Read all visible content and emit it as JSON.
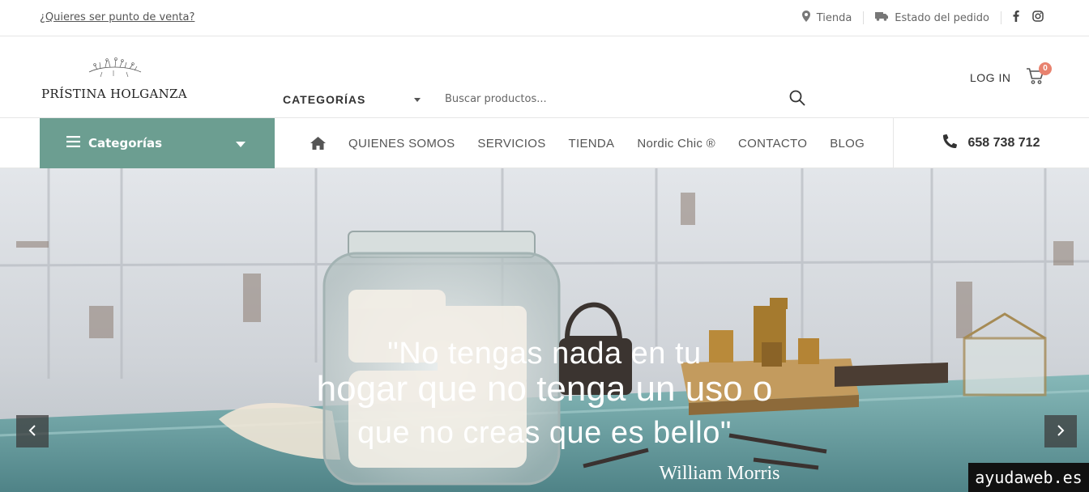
{
  "topbar": {
    "promo_link": "¿Quieres ser punto de venta?",
    "store_label": "Tienda",
    "order_status_label": "Estado del pedido",
    "social": [
      "facebook-icon",
      "instagram-icon"
    ]
  },
  "header": {
    "brand_name": "PRÍSTINA HOLGANZA",
    "category_select": "CATEGORÍAS",
    "search_placeholder": "Buscar productos...",
    "login_label": "LOG IN",
    "cart_count": "0"
  },
  "nav": {
    "categories_button": "Categorías",
    "items": [
      "QUIENES SOMOS",
      "SERVICIOS",
      "TIENDA",
      "Nordic Chic ®",
      "CONTACTO",
      "BLOG"
    ],
    "phone": "658 738 712"
  },
  "hero": {
    "quote_line1": "\"No tengas nada en tu",
    "quote_line2": "hogar que no tenga un uso o",
    "quote_line3": "que no creas que es bello\"",
    "author": "William Morris",
    "watermark": "ayudaweb.es"
  },
  "colors": {
    "accent": "#6c9e91",
    "cart_badge": "#e8826f"
  }
}
